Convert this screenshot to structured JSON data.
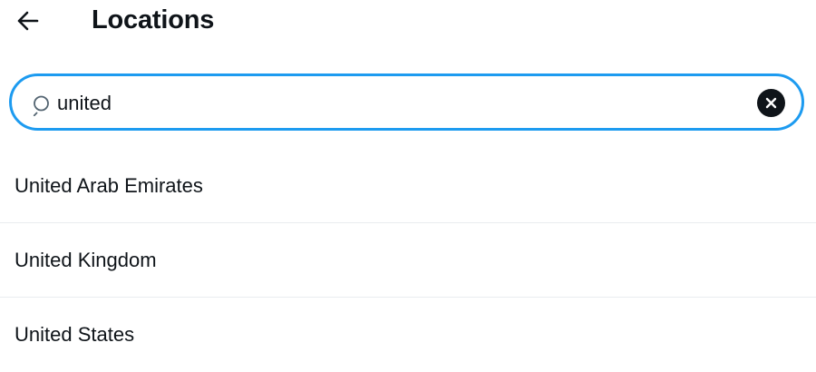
{
  "header": {
    "back_icon": "arrow-left-icon",
    "title": "Locations"
  },
  "search": {
    "icon": "search-icon",
    "value": "united",
    "clear_icon": "close-icon"
  },
  "results": [
    {
      "label": "United Arab Emirates"
    },
    {
      "label": "United Kingdom"
    },
    {
      "label": "United States"
    }
  ],
  "colors": {
    "accent": "#1d9bf0",
    "text": "#0f1419",
    "divider": "#e9ecef",
    "background": "#ffffff"
  }
}
